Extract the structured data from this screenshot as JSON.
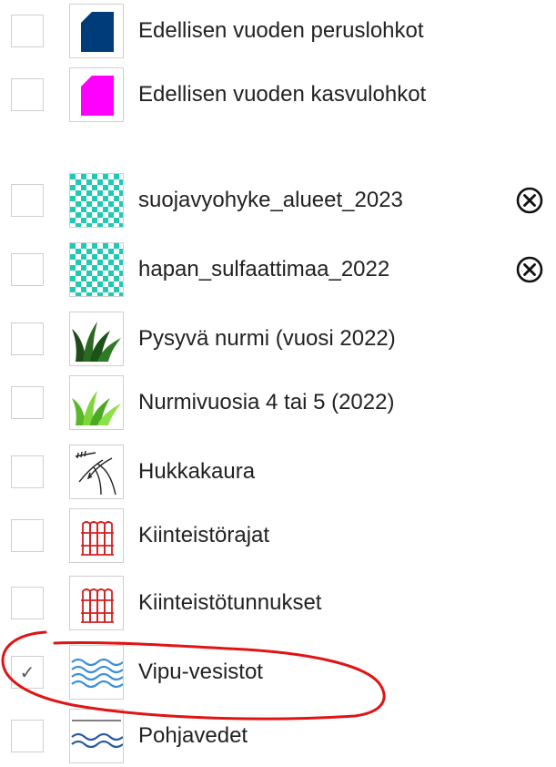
{
  "layers": [
    {
      "label": "Edellisen vuoden peruslohkot",
      "icon": "block-shape-icon",
      "color": "#003b7a",
      "checked": false
    },
    {
      "label": "Edellisen vuoden kasvulohkot",
      "icon": "block-shape-icon",
      "color": "#ff00ff",
      "checked": false
    },
    {
      "label": "suojavyohyke_alueet_2023",
      "icon": "checker-pattern-icon",
      "color": "#1fc9b4",
      "checked": false,
      "removable": true
    },
    {
      "label": "hapan_sulfaattimaa_2022",
      "icon": "checker-pattern-icon",
      "color": "#1fc9b4",
      "checked": false,
      "removable": true
    },
    {
      "label": "Pysyvä nurmi (vuosi 2022)",
      "icon": "grass-dark-icon",
      "color": "#1f5a1f",
      "checked": false
    },
    {
      "label": "Nurmivuosia 4 tai 5 (2022)",
      "icon": "grass-light-icon",
      "color": "#6ccf2e",
      "checked": false
    },
    {
      "label": "Hukkakaura",
      "icon": "wild-oat-icon",
      "color": "#222222",
      "checked": false
    },
    {
      "label": "Kiinteistörajat",
      "icon": "fence-icon",
      "color": "#d42020",
      "checked": false
    },
    {
      "label": "Kiinteistötunnukset",
      "icon": "fence-icon",
      "color": "#d42020",
      "checked": false
    },
    {
      "label": "Vipu-vesistot",
      "icon": "waves-icon",
      "color": "#3a8fd8",
      "checked": true,
      "check_glyph": "✓"
    },
    {
      "label": "Pohjavedet",
      "icon": "groundwater-icon",
      "color": "#2a5aa0",
      "checked": false
    }
  ]
}
